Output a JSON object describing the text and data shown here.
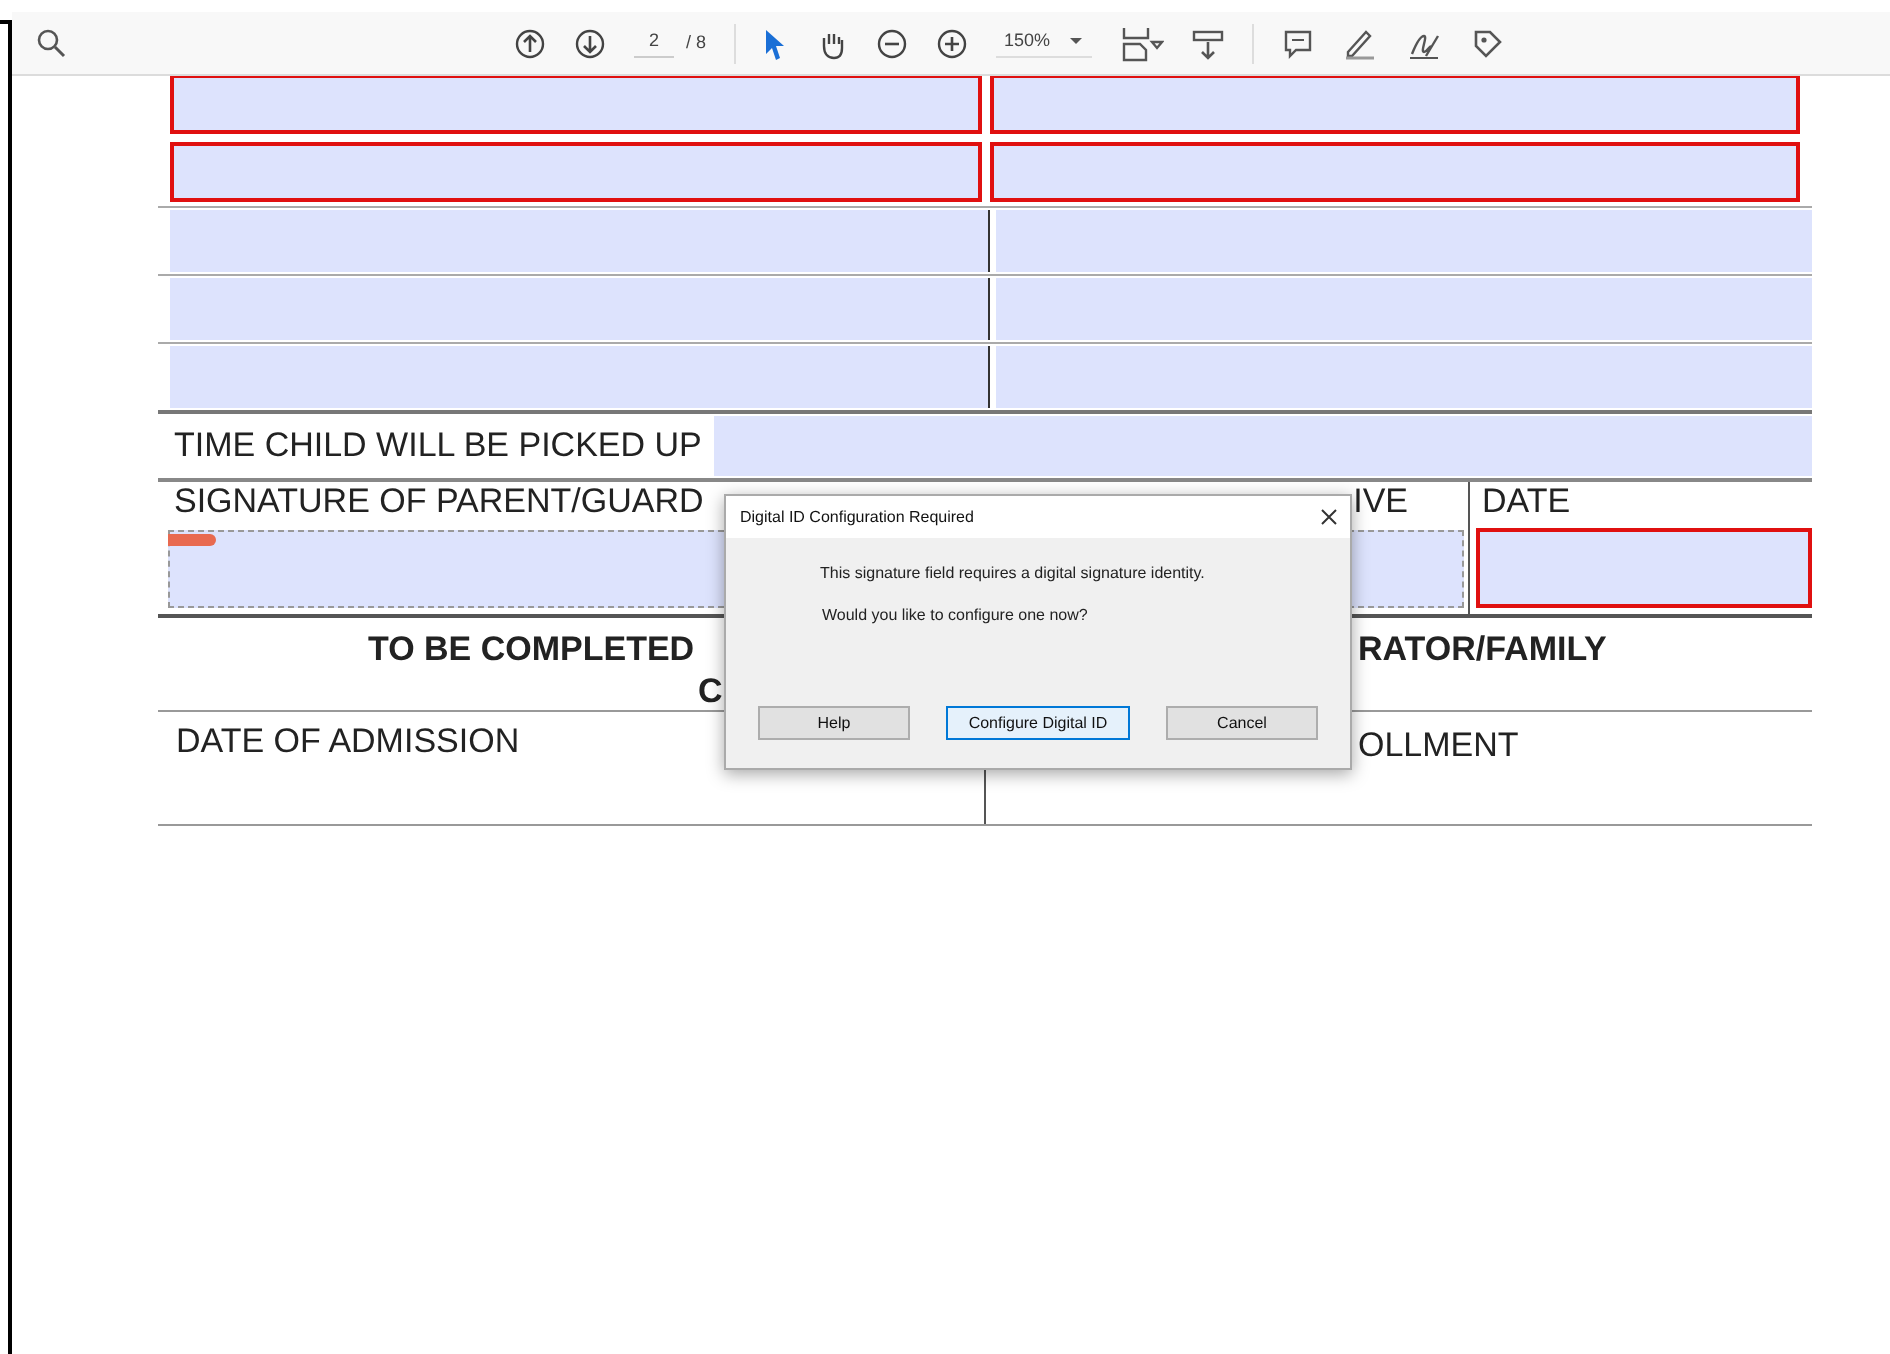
{
  "toolbar": {
    "page": "2",
    "page_count": "/ 8",
    "zoom": "150%"
  },
  "field_rows": [
    {
      "kind": "boxed",
      "cells": [
        {
          "required": true
        },
        {
          "required": true
        }
      ]
    },
    {
      "kind": "boxed",
      "cells": [
        {
          "required": true
        },
        {
          "required": true
        }
      ]
    },
    {
      "kind": "lined",
      "cells": [
        {
          "required": false
        },
        {
          "required": false
        }
      ]
    },
    {
      "kind": "lined",
      "cells": [
        {
          "required": false
        },
        {
          "required": false
        }
      ]
    },
    {
      "kind": "lined",
      "cells": [
        {
          "required": false
        },
        {
          "required": false
        }
      ]
    }
  ],
  "pickup": {
    "label": "TIME CHILD WILL BE PICKED UP"
  },
  "signature": {
    "label": "SIGNATURE OF PARENT/GUARD",
    "label_2": "IVE",
    "date_label": "DATE",
    "date_required": true
  },
  "section": {
    "title": "TO BE COMPLETED",
    "title_2": "RATOR/FAMILY",
    "title_3": "C"
  },
  "admission": {
    "left": "DATE OF ADMISSION",
    "right": "OLLMENT"
  },
  "dialog": {
    "title": "Digital ID Configuration Required",
    "message": "This signature field requires a digital signature identity.",
    "question": "Would you like to configure one now?",
    "buttons": [
      {
        "label": "Help",
        "selected": false
      },
      {
        "label": "Configure Digital ID",
        "selected": true
      },
      {
        "label": "Cancel",
        "selected": false
      }
    ]
  }
}
